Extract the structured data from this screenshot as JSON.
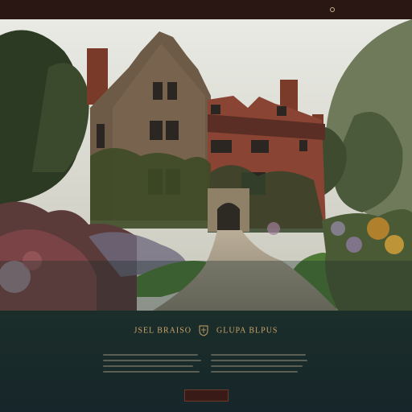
{
  "nav": {
    "items": [
      "",
      "",
      "",
      "",
      ""
    ]
  },
  "hero": {
    "script_title": ""
  },
  "wordmark": {
    "left": "JSEL BRAISO",
    "right": "GLUPA BLPUS"
  },
  "cta": {
    "label": ""
  },
  "colors": {
    "nav_bg": "#2a1714",
    "accent_gold": "#c9a46a",
    "lower_bg": "#1b2e2a",
    "cta_bg": "#3a1a16"
  }
}
